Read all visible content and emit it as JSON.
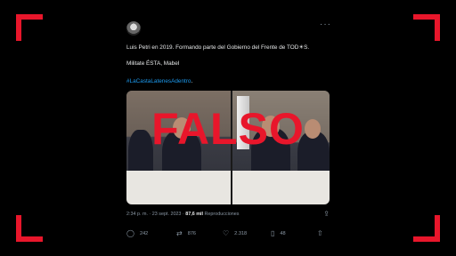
{
  "tweet": {
    "line1": "Luis Petri en 2019. Formando parte del Gobierno del Frente de TOD☀S.",
    "line2": "Militate ÉSTA, Mabel",
    "hashtag": "#LaCastaLatenesAdentro",
    "hashtag_suffix": ".",
    "overlay_label": "FALSO",
    "time": "2:34 p. m. · 23 sept. 2023 · ",
    "views": "87,6 mil",
    "views_label": " Reproducciones",
    "more": "···"
  },
  "actions": {
    "replies": "242",
    "retweets": "876",
    "likes": "2.318",
    "bookmarks": "48"
  },
  "icons": {
    "reply": "reply-icon",
    "retweet": "retweet-icon",
    "like": "heart-icon",
    "bookmark": "bookmark-icon",
    "share": "share-icon"
  },
  "colors": {
    "accent_red": "#e8162b",
    "link_blue": "#1d9bf0"
  }
}
